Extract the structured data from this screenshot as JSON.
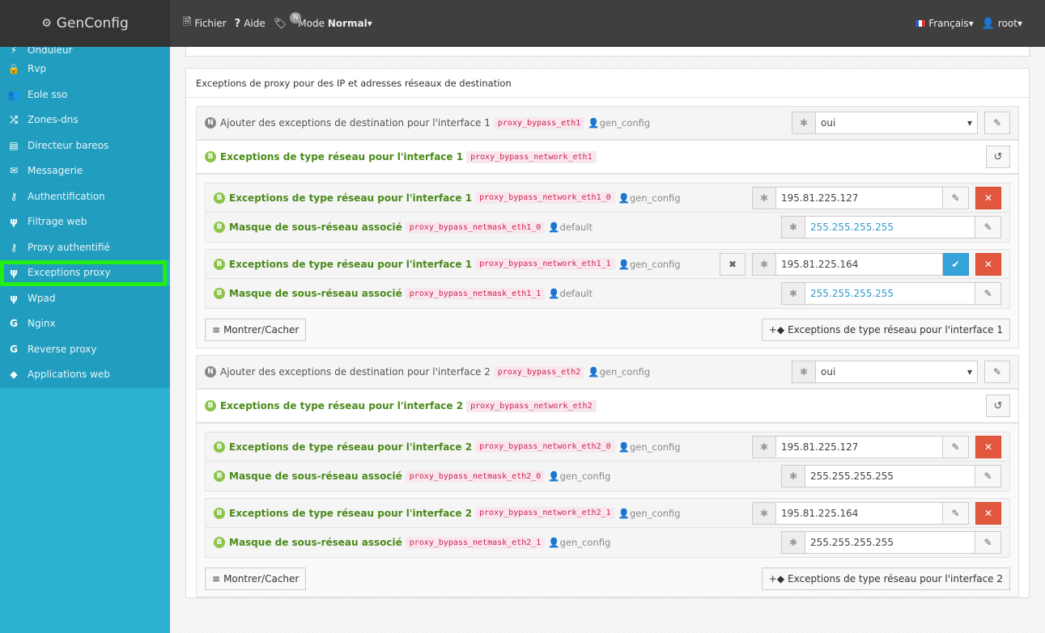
{
  "app": {
    "title": "GenConfig"
  },
  "topbar": {
    "fichier": "Fichier",
    "aide": "Aide",
    "mode_badge": "N",
    "mode_label": "Mode",
    "mode_value": "Normal",
    "language": "Français",
    "user": "root"
  },
  "sidebar": {
    "items": [
      {
        "label": "Onduleur",
        "icon": "⚡"
      },
      {
        "label": "Rvp",
        "icon": "🔒"
      },
      {
        "label": "Eole sso",
        "icon": "👥"
      },
      {
        "label": "Zones-dns",
        "icon": "⤮"
      },
      {
        "label": "Directeur bareos",
        "icon": "▤"
      },
      {
        "label": "Messagerie",
        "icon": "✉"
      },
      {
        "label": "Authentification",
        "icon": "⚷"
      },
      {
        "label": "Filtrage web",
        "icon": "ψ"
      },
      {
        "label": "Proxy authentifié",
        "icon": "⚷"
      },
      {
        "label": "Exceptions proxy",
        "icon": "ψ"
      },
      {
        "label": "Wpad",
        "icon": "ψ"
      },
      {
        "label": "Nginx",
        "icon": "G"
      },
      {
        "label": "Reverse proxy",
        "icon": "G"
      },
      {
        "label": "Applications web",
        "icon": "◆"
      }
    ]
  },
  "main": {
    "section_title": "Exceptions de proxy pour des IP et adresses réseaux de destination",
    "show_hide": "Montrer/Cacher",
    "interfaces": [
      {
        "add_label": "Ajouter des exceptions de destination pour l'interface 1",
        "add_var": "proxy_bypass_eth1",
        "add_user": "gen_config",
        "add_value": "oui",
        "net_label": "Exceptions de type réseau pour l'interface 1",
        "net_var": "proxy_bypass_network_eth1",
        "add_button": "Exceptions de type réseau pour l'interface 1",
        "entries": [
          {
            "label": "Exceptions de type réseau pour l'interface 1",
            "var": "proxy_bypass_network_eth1_0",
            "user": "gen_config",
            "value": "195.81.225.127",
            "mask_label": "Masque de sous-réseau associé",
            "mask_var": "proxy_bypass_netmask_eth1_0",
            "mask_user": "default",
            "mask_value": "255.255.255.255"
          },
          {
            "label": "Exceptions de type réseau pour l'interface 1",
            "var": "proxy_bypass_network_eth1_1",
            "user": "gen_config",
            "value": "195.81.225.164",
            "mask_label": "Masque de sous-réseau associé",
            "mask_var": "proxy_bypass_netmask_eth1_1",
            "mask_user": "default",
            "mask_value": "255.255.255.255"
          }
        ]
      },
      {
        "add_label": "Ajouter des exceptions de destination pour l'interface 2",
        "add_var": "proxy_bypass_eth2",
        "add_user": "gen_config",
        "add_value": "oui",
        "net_label": "Exceptions de type réseau pour l'interface 2",
        "net_var": "proxy_bypass_network_eth2",
        "add_button": "Exceptions de type réseau pour l'interface 2",
        "entries": [
          {
            "label": "Exceptions de type réseau pour l'interface 2",
            "var": "proxy_bypass_network_eth2_0",
            "user": "gen_config",
            "value": "195.81.225.127",
            "mask_label": "Masque de sous-réseau associé",
            "mask_var": "proxy_bypass_netmask_eth2_0",
            "mask_user": "gen_config",
            "mask_value": "255.255.255.255"
          },
          {
            "label": "Exceptions de type réseau pour l'interface 2",
            "var": "proxy_bypass_network_eth2_1",
            "user": "gen_config",
            "value": "195.81.225.164",
            "mask_label": "Masque de sous-réseau associé",
            "mask_var": "proxy_bypass_netmask_eth2_1",
            "mask_user": "gen_config",
            "mask_value": "255.255.255.255"
          }
        ]
      }
    ]
  },
  "colors": {
    "sidebar": "#2cb1d2",
    "highlight": "#22ee11",
    "green_label": "#4a8a1a",
    "danger": "#e2583e",
    "confirm": "#35a2d9"
  }
}
